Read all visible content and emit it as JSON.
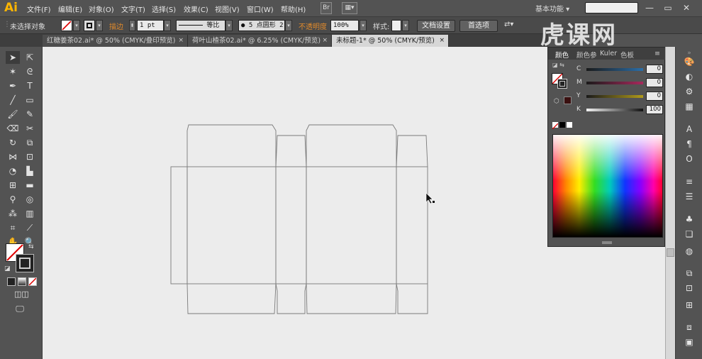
{
  "app": {
    "logo": "Ai"
  },
  "menu": [
    "文件(F)",
    "编辑(E)",
    "对象(O)",
    "文字(T)",
    "选择(S)",
    "效果(C)",
    "视图(V)",
    "窗口(W)",
    "帮助(H)"
  ],
  "menubar_icons": {
    "bridge": "Br"
  },
  "workspace": "基本功能",
  "watermark": "虎课网",
  "control": {
    "selection": "未选择对象",
    "stroke_label": "描边",
    "stroke_weight": "1 pt",
    "profile": "等比",
    "brush": "5 点圆形",
    "brush_extra": "2",
    "opacity_label": "不透明度",
    "opacity_value": "100%",
    "style_label": "样式:",
    "doc_setup": "文档设置",
    "preferences": "首选项"
  },
  "tabs": [
    {
      "label": "红糖姜茶02.ai* @ 50% (CMYK/叠印预览)",
      "active": false
    },
    {
      "label": "荷叶山楂茶02.ai* @ 6.25% (CMYK/预览)",
      "active": false
    },
    {
      "label": "未标题-1* @ 50% (CMYK/预览)",
      "active": true
    }
  ],
  "tab_close": "×",
  "color_panel": {
    "tabs": [
      "颜色",
      "颜色参",
      "Kuler",
      "色板"
    ],
    "sliders": [
      {
        "label": "C",
        "value": "0",
        "color": "#2b6ea8"
      },
      {
        "label": "M",
        "value": "0",
        "color": "#a8285c"
      },
      {
        "label": "Y",
        "value": "0",
        "color": "#b09a1a"
      },
      {
        "label": "K",
        "value": "100",
        "color": "#333333"
      }
    ],
    "percent": "%"
  },
  "accent_colors": {
    "logo": "#ffb600",
    "orange_label": "#e08a2b"
  }
}
